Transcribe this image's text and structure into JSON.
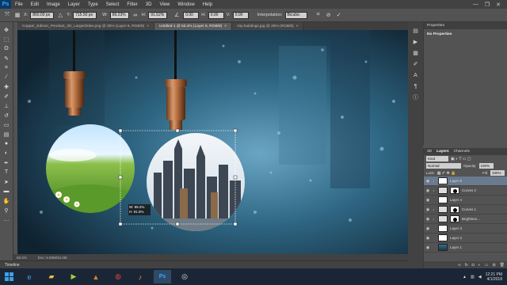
{
  "app": {
    "logo": "Ps"
  },
  "menu": [
    "File",
    "Edit",
    "Image",
    "Layer",
    "Type",
    "Select",
    "Filter",
    "3D",
    "View",
    "Window",
    "Help"
  ],
  "window_controls": [
    "—",
    "❐",
    "✕"
  ],
  "options": {
    "x_label": "X:",
    "x_value": "850.00 px",
    "y_label": "Y:",
    "y_value": "715.50 px",
    "w_label": "W:",
    "w_value": "89.23%",
    "h_label": "H:",
    "h_value": "91.52%",
    "angle_value": "0.00",
    "hskew_label": "H:",
    "hskew_value": "0.00",
    "vskew_label": "V:",
    "vskew_value": "0.00",
    "interp_label": "Interpolation:",
    "interp_value": "Bicubic"
  },
  "tabs": [
    {
      "label": "Copper_Edison_Pendant_3D_LargeGlobe.png @ 25% (Layer 6, RGB/8)",
      "close": "×"
    },
    {
      "label": "Untitled-1 @ 53.4% (Layer 6, RGB/8)",
      "close": "×",
      "active": true
    },
    {
      "label": "city-buildings.jpg @ 25% (RGB/8)",
      "close": "×"
    }
  ],
  "transform_readout": {
    "w": "W: 89.2%",
    "h": "H: 91.5%"
  },
  "status": {
    "zoom": "53.4%",
    "doc": "Doc: 5.93M/34.2M"
  },
  "timeline_label": "Timeline",
  "properties": {
    "tab1": "Properties",
    "no_props": "No Properties"
  },
  "layers_panel": {
    "tab_3d": "3D",
    "tab_layers": "Layers",
    "tab_channels": "Channels",
    "kind_label": "Kind",
    "blend_mode": "Normal",
    "opacity_label": "Opacity:",
    "opacity_value": "100%",
    "lock_label": "Lock:",
    "fill_label": "Fill:",
    "fill_value": "100%",
    "layers": [
      {
        "name": "Layer 6",
        "selected": true
      },
      {
        "name": "Curves 2",
        "adjustment": true
      },
      {
        "name": "Layer 4"
      },
      {
        "name": "Curves 1",
        "adjustment": true
      },
      {
        "name": "Brightnes...",
        "adjustment": true
      },
      {
        "name": "Layer 3"
      },
      {
        "name": "Layer 2"
      },
      {
        "name": "Layer 1"
      }
    ]
  },
  "taskbar": {
    "time": "12:21 PM",
    "date": "4/1/2018"
  },
  "colors": {
    "foreground": "#5aa0dd",
    "background": "#1d4f7c",
    "accent": "#31a8ff"
  }
}
